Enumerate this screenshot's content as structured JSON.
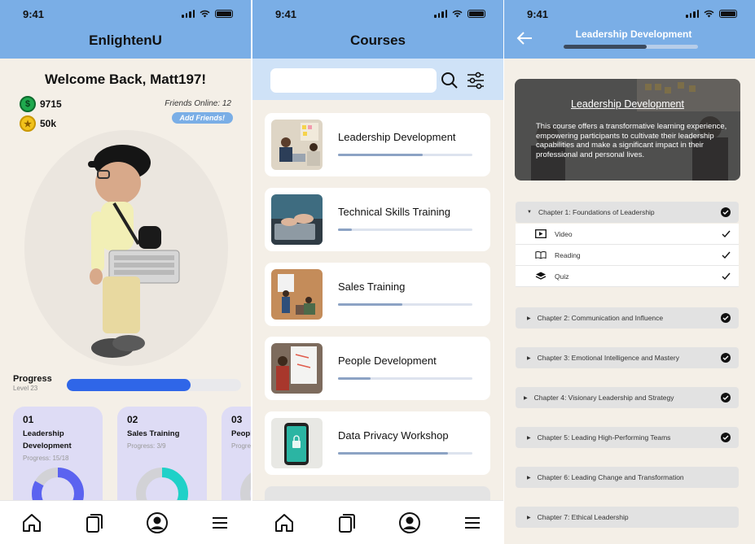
{
  "status_time": "9:41",
  "screen1": {
    "title": "EnlightenU",
    "welcome": "Welcome Back, Matt197!",
    "coins": "9715",
    "stars": "50k",
    "friends_online": "Friends Online: 12",
    "add_friends": "Add Friends!",
    "progress_label": "Progress",
    "level": "Level 23",
    "progress_fraction": 0.71,
    "cards": [
      {
        "num": "01",
        "name": "Leadership Development",
        "progress": "Progress: 15/18",
        "fraction": 0.83,
        "color": "#5b63f0"
      },
      {
        "num": "02",
        "name": "Sales Training",
        "progress": "Progress: 3/9",
        "fraction": 0.33,
        "color": "#1fd1c8"
      },
      {
        "num": "03",
        "name": "People Development",
        "progress": "Progress",
        "fraction": 0.2,
        "color": "#cccccc"
      }
    ]
  },
  "screen2": {
    "title": "Courses",
    "search_placeholder": "",
    "courses": [
      {
        "name": "Leadership Development",
        "progress": 0.63
      },
      {
        "name": "Technical Skills Training",
        "progress": 0.1
      },
      {
        "name": "Sales Training",
        "progress": 0.48
      },
      {
        "name": "People Development",
        "progress": 0.24
      },
      {
        "name": "Data Privacy Workshop",
        "progress": 0.82
      }
    ]
  },
  "screen3": {
    "title": "Leadership Development",
    "progress": 0.62,
    "hero_title": "Leadership Development",
    "hero_desc": "This course offers a transformative learning experience, empowering participants to cultivate their leadership capabilities and make a significant impact in their professional and personal lives.",
    "chapter1": "Chapter 1: Foundations of Leadership",
    "lessons": [
      {
        "label": "Video",
        "icon": "play-icon"
      },
      {
        "label": "Reading",
        "icon": "book-icon"
      },
      {
        "label": "Quiz",
        "icon": "layers-icon"
      }
    ],
    "chapters": [
      {
        "label": "Chapter 2: Communication and Influence",
        "done": true
      },
      {
        "label": "Chapter 3: Emotional Intelligence and Mastery",
        "done": true
      },
      {
        "label": "Chapter 4: Visionary Leadership and Strategy",
        "done": true
      },
      {
        "label": "Chapter 5: Leading High-Performing Teams",
        "done": true
      },
      {
        "label": "Chapter 6: Leading Change and Transformation",
        "done": false
      },
      {
        "label": "Chapter 7: Ethical Leadership",
        "done": false
      }
    ]
  },
  "colors": {
    "header": "#7aaee6",
    "background": "#f4efe7",
    "progress_blue": "#2f66e8"
  }
}
